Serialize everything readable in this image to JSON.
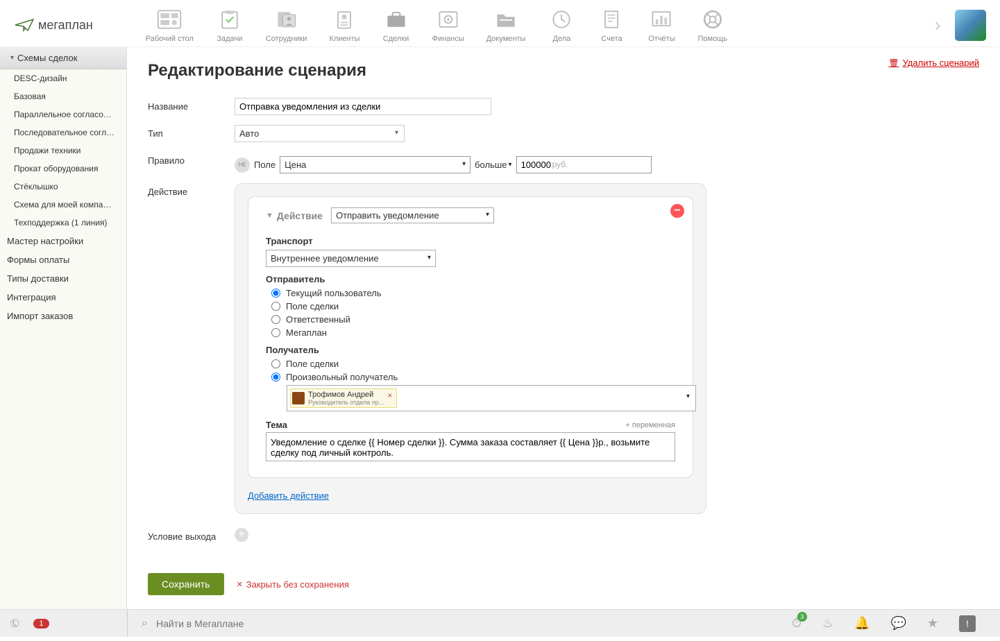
{
  "logo": "мегаплан",
  "nav": [
    {
      "label": "Рабочий стол"
    },
    {
      "label": "Задачи"
    },
    {
      "label": "Сотрудники"
    },
    {
      "label": "Клиенты"
    },
    {
      "label": "Сделки"
    },
    {
      "label": "Финансы"
    },
    {
      "label": "Документы"
    },
    {
      "label": "Дела"
    },
    {
      "label": "Счета"
    },
    {
      "label": "Отчёты"
    },
    {
      "label": "Помощь"
    }
  ],
  "sidebar": {
    "header": "Схемы сделок",
    "items": [
      "DESC-дизайн",
      "Базовая",
      "Параллельное согласование",
      "Последовательное согласов...",
      "Продажи техники",
      "Прокат оборудования",
      "Стёклышко",
      "Схема для моей компании",
      "Техподдержка (1 линия)"
    ],
    "groups": [
      "Мастер настройки",
      "Формы оплаты",
      "Типы доставки",
      "Интеграция",
      "Импорт заказов"
    ]
  },
  "delete_link": "Удалить сценарий",
  "page_title": "Редактирование сценария",
  "labels": {
    "name": "Название",
    "type": "Тип",
    "rule": "Правило",
    "action": "Действие",
    "exit": "Условие выхода"
  },
  "form": {
    "name_value": "Отправка уведомления из сделки",
    "type_value": "Авто",
    "rule": {
      "ne": "НЕ",
      "field_label": "Поле",
      "field_value": "Цена",
      "operator": "больше",
      "value": "100000",
      "unit": "руб."
    }
  },
  "action": {
    "title": "Действие",
    "select": "Отправить уведомление",
    "transport_label": "Транспорт",
    "transport_value": "Внутреннее уведомление",
    "sender_label": "Отправитель",
    "sender_options": [
      "Текущий пользователь",
      "Поле сделки",
      "Ответственный",
      "Мегаплан"
    ],
    "recipient_label": "Получатель",
    "recipient_options": [
      "Поле сделки",
      "Произвольный получатель"
    ],
    "chip_name": "Трофимов Андрей",
    "chip_role": "Руководитель отдела пр...",
    "theme_label": "Тема",
    "add_var": "+ переменная",
    "theme_value": "Уведомление о сделке {{ Номер сделки }}. Сумма заказа составляет {{ Цена }}р., возьмите сделку под личный контроль.",
    "add_action": "Добавить действие"
  },
  "buttons": {
    "save": "Сохранить",
    "close": "Закрыть без сохранения"
  },
  "bottom": {
    "phone_badge": "1",
    "search_placeholder": "Найти в Мегаплане",
    "clock_badge": "3"
  }
}
